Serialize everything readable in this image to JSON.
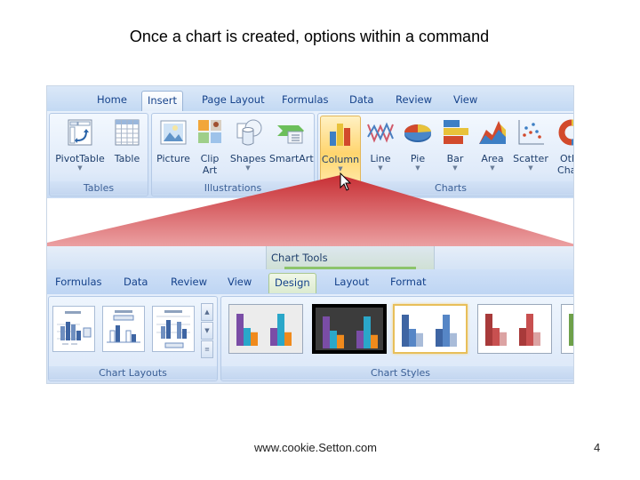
{
  "slide": {
    "title": "Once a chart is created, options within a command",
    "footer_url": "www.cookie.Setton.com",
    "page_number": "4"
  },
  "insert_ribbon": {
    "tabs": [
      {
        "label": "Home",
        "active": false
      },
      {
        "label": "Insert",
        "active": true
      },
      {
        "label": "Page Layout",
        "active": false
      },
      {
        "label": "Formulas",
        "active": false
      },
      {
        "label": "Data",
        "active": false
      },
      {
        "label": "Review",
        "active": false
      },
      {
        "label": "View",
        "active": false
      }
    ],
    "groups": [
      {
        "label": "Tables",
        "commands": [
          {
            "label": "PivotTable",
            "icon": "pivot-table-icon",
            "dropdown": true
          },
          {
            "label": "Table",
            "icon": "table-icon",
            "dropdown": false
          }
        ]
      },
      {
        "label": "Illustrations",
        "commands": [
          {
            "label": "Picture",
            "icon": "picture-icon",
            "dropdown": false
          },
          {
            "label": "Clip",
            "label2": "Art",
            "icon": "clip-art-icon",
            "dropdown": false
          },
          {
            "label": "Shapes",
            "icon": "shapes-icon",
            "dropdown": true
          },
          {
            "label": "SmartArt",
            "icon": "smartart-icon",
            "dropdown": false
          }
        ]
      },
      {
        "label": "Charts",
        "commands": [
          {
            "label": "Column",
            "icon": "column-chart-icon",
            "dropdown": true,
            "highlighted": true
          },
          {
            "label": "Line",
            "icon": "line-chart-icon",
            "dropdown": true
          },
          {
            "label": "Pie",
            "icon": "pie-chart-icon",
            "dropdown": true
          },
          {
            "label": "Bar",
            "icon": "bar-chart-icon",
            "dropdown": true
          },
          {
            "label": "Area",
            "icon": "area-chart-icon",
            "dropdown": true
          },
          {
            "label": "Scatter",
            "icon": "scatter-chart-icon",
            "dropdown": true
          },
          {
            "label": "Oth",
            "label2": "Char",
            "icon": "other-charts-icon",
            "dropdown": false
          }
        ]
      }
    ]
  },
  "chart_tools": {
    "context_label": "Chart Tools",
    "tabs": [
      {
        "label": "Formulas",
        "active": false
      },
      {
        "label": "Data",
        "active": false
      },
      {
        "label": "Review",
        "active": false
      },
      {
        "label": "View",
        "active": false
      },
      {
        "label": "Design",
        "active": true
      },
      {
        "label": "Layout",
        "active": false
      },
      {
        "label": "Format",
        "active": false
      }
    ],
    "groups": [
      {
        "label": "Chart Layouts",
        "items": [
          "layout-1",
          "layout-2",
          "layout-3"
        ],
        "scroll": [
          "▲",
          "▼",
          "≡"
        ]
      },
      {
        "label": "Chart Styles",
        "items": [
          {
            "name": "style-multicolor-light",
            "bg": "#ececec",
            "colors": [
              "#7a4da6",
              "#2aa7c9",
              "#f08a1c"
            ]
          },
          {
            "name": "style-multicolor-dark",
            "bg": "#3c3c3c",
            "colors": [
              "#7a4da6",
              "#2aa7c9",
              "#f08a1c"
            ]
          },
          {
            "name": "style-blue",
            "bg": "#ffffff",
            "colors": [
              "#3e65a3",
              "#5686c6",
              "#a9bcd9"
            ],
            "selected": true
          },
          {
            "name": "style-red",
            "bg": "#ffffff",
            "colors": [
              "#a83a3a",
              "#c85050",
              "#dca3a3"
            ]
          },
          {
            "name": "style-green",
            "bg": "#ffffff",
            "colors": [
              "#6ea04a",
              "#8cc06a",
              "#c2dcae"
            ]
          }
        ]
      }
    ]
  },
  "colors": {
    "callout_red": "#c8383c",
    "ribbon_blue": "#c3d9f3",
    "tab_text": "#15428b",
    "hot_gold": "#ffd56e"
  }
}
